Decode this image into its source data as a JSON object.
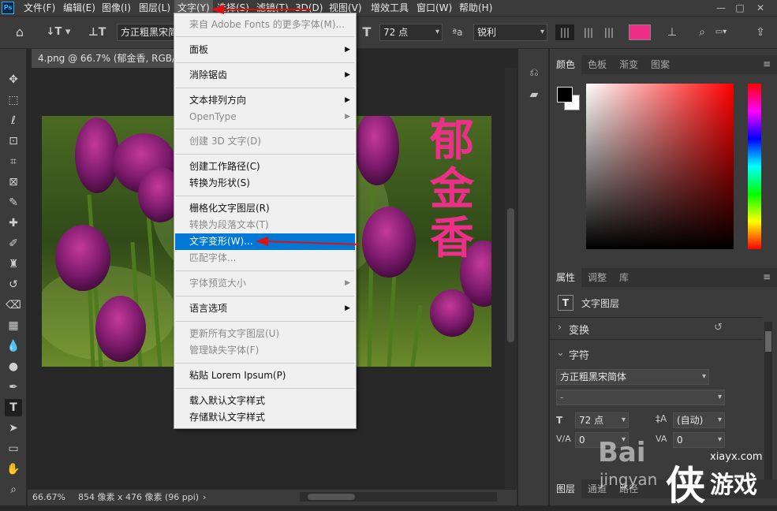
{
  "menubar": {
    "items": [
      "文件(F)",
      "编辑(E)",
      "图像(I)",
      "图层(L)",
      "文字(Y)",
      "选择(S)",
      "滤镜(T)",
      "3D(D)",
      "视图(V)",
      "增效工具",
      "窗口(W)",
      "帮助(H)"
    ],
    "active_index": 4
  },
  "options": {
    "font_family": "方正粗黑宋简",
    "font_size": "72 点",
    "aa_mode": "锐利",
    "aa_label": "ªa",
    "text_color": "#ee2f8a"
  },
  "document": {
    "tab_title": "4.png @ 66.7% (郁金香, RGB/8#)",
    "vertical_text": [
      "郁",
      "金",
      "香"
    ],
    "text_color": "#ee2f8a"
  },
  "status": {
    "zoom": "66.67%",
    "info": "854 像素 x 476 像素 (96 ppi)"
  },
  "text_menu": {
    "rows": [
      {
        "label": "来自 Adobe Fonts 的更多字体(M)...",
        "disabled": true
      },
      {
        "label": "面板",
        "submenu": true
      },
      {
        "label": "消除锯齿",
        "submenu": true
      },
      {
        "label": "文本排列方向",
        "submenu": true
      },
      {
        "label": "OpenType",
        "submenu": true,
        "disabled": true
      },
      {
        "label": "创建 3D 文字(D)",
        "disabled": true
      },
      {
        "label": "创建工作路径(C)"
      },
      {
        "label": "转换为形状(S)"
      },
      {
        "label": "栅格化文字图层(R)"
      },
      {
        "label": "转换为段落文本(T)",
        "disabled": true
      },
      {
        "label": "文字变形(W)...",
        "highlight": true
      },
      {
        "label": "匹配字体...",
        "disabled": true
      },
      {
        "label": "字体预览大小",
        "submenu": true,
        "disabled": true
      },
      {
        "label": "语言选项",
        "submenu": true
      },
      {
        "label": "更新所有文字图层(U)",
        "disabled": true
      },
      {
        "label": "管理缺失字体(F)",
        "disabled": true
      },
      {
        "label": "粘贴 Lorem Ipsum(P)"
      },
      {
        "label": "载入默认文字样式"
      },
      {
        "label": "存储默认文字样式"
      }
    ]
  },
  "color_panel": {
    "tabs": [
      "颜色",
      "色板",
      "渐变",
      "图案"
    ],
    "foreground": "#000000",
    "background": "#ffffff",
    "hue_color": "#ff0000"
  },
  "properties_panel": {
    "tabs": [
      "属性",
      "调整",
      "库"
    ],
    "layer_type": "文字图层",
    "transform_label": "变换",
    "character_label": "字符",
    "font_family": "方正粗黑宋简体",
    "font_style": "-",
    "font_size": "72 点",
    "leading": "(自动)",
    "kerning": "0",
    "tracking": "0"
  },
  "bottom_tabs": [
    "图层",
    "通道",
    "路径"
  ],
  "watermark": {
    "baidu": "Bai",
    "jingyan": "jingyan",
    "site": "xiayx.com",
    "brand": "游戏",
    "brand_icon": "侠"
  }
}
